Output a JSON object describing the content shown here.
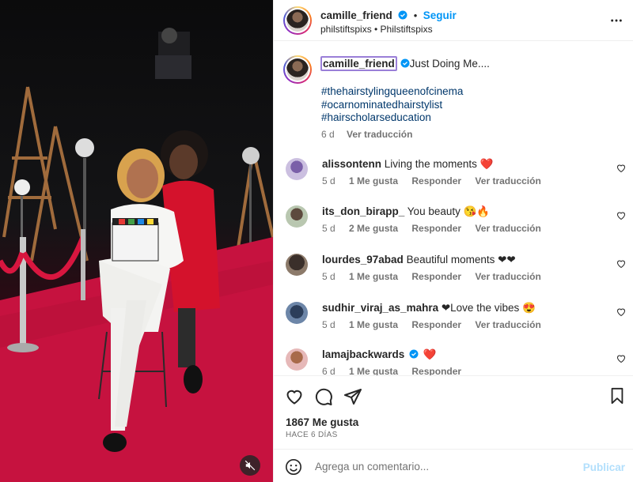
{
  "post": {
    "username": "camille_friend",
    "follow_label": "Seguir",
    "collaborators": "philstiftspixs • Philstiftspixs",
    "more_icon": "more-horizontal-icon"
  },
  "caption": {
    "username": "camille_friend",
    "text": "Just Doing Me....",
    "hashtags": [
      "#thehairstylingqueenofcinema",
      "#ocarnominatedhairstylist",
      "#hairscholarseducation"
    ],
    "time": "6 d",
    "translate": "Ver traducción"
  },
  "comments": [
    {
      "user": "alissontenn",
      "text": "Living the moments ❤️",
      "time": "5 d",
      "likes": "1 Me gusta",
      "reply": "Responder",
      "translate": "Ver traducción",
      "verified": false
    },
    {
      "user": "its_don_birapp_",
      "text": "You beauty 😘🔥",
      "time": "5 d",
      "likes": "2 Me gusta",
      "reply": "Responder",
      "translate": "Ver traducción",
      "verified": false
    },
    {
      "user": "lourdes_97abad",
      "text": "Beautiful moments ❤❤",
      "time": "5 d",
      "likes": "1 Me gusta",
      "reply": "Responder",
      "translate": "Ver traducción",
      "verified": false
    },
    {
      "user": "sudhir_viraj_as_mahra",
      "text": "❤Love the vibes 😍",
      "time": "5 d",
      "likes": "1 Me gusta",
      "reply": "Responder",
      "translate": "Ver traducción",
      "verified": false
    },
    {
      "user": "lamajbackwards",
      "text": "❤️",
      "time": "6 d",
      "likes": "1 Me gusta",
      "reply": "Responder",
      "translate": "",
      "verified": true
    }
  ],
  "stats": {
    "likes": "1867 Me gusta",
    "date": "HACE 6 DÍAS"
  },
  "composer": {
    "placeholder": "Agrega un comentario...",
    "publish": "Publicar"
  },
  "colors": {
    "accent": "#0095f6",
    "hashtag": "#00376b",
    "muted": "#737373"
  }
}
